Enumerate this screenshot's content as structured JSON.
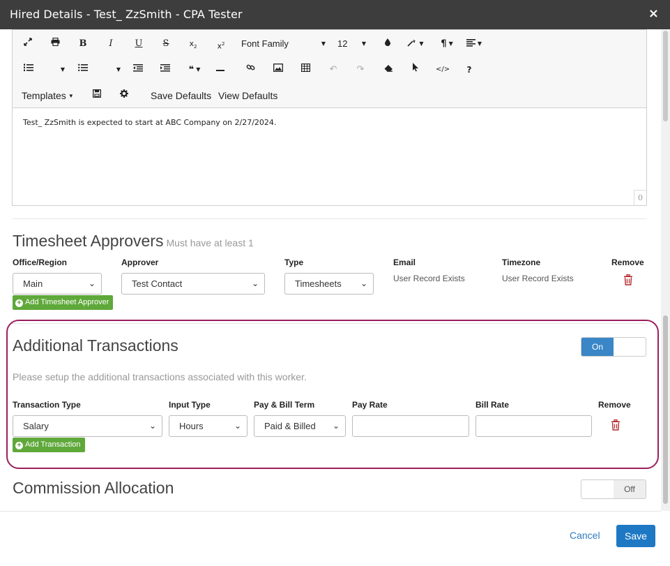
{
  "modal": {
    "title": "Hired Details - Test_ ZzSmith - CPA Tester",
    "close_label": "×"
  },
  "editor": {
    "font_family_label": "Font Family",
    "font_size": "12",
    "templates_label": "Templates",
    "save_defaults_label": "Save Defaults",
    "view_defaults_label": "View Defaults",
    "help_label": "?",
    "body_text": "Test_ ZzSmith is expected to start at ABC Company on 2/27/2024.",
    "char_count": "0",
    "icons": [
      "expand-icon",
      "print-icon",
      "bold-icon",
      "italic-icon",
      "underline-icon",
      "strikethrough-icon",
      "subscript-icon",
      "superscript-icon",
      "color-icon",
      "magic-icon",
      "paragraph-icon",
      "align-icon",
      "ordered-list-icon",
      "unordered-list-icon",
      "outdent-icon",
      "indent-icon",
      "quote-icon",
      "horizontal-rule-icon",
      "link-icon",
      "image-icon",
      "table-icon",
      "undo-icon",
      "redo-icon",
      "eraser-icon",
      "pointer-icon",
      "code-view-icon",
      "help-icon",
      "save-icon",
      "gear-icon"
    ]
  },
  "timesheet": {
    "title": "Timesheet Approvers",
    "note": "Must have at least 1",
    "headers": {
      "office": "Office/Region",
      "approver": "Approver",
      "type": "Type",
      "email": "Email",
      "timezone": "Timezone",
      "remove": "Remove"
    },
    "row": {
      "office": "Main",
      "approver": "Test Contact",
      "type": "Timesheets",
      "email": "User Record Exists",
      "timezone": "User Record Exists"
    },
    "add_label": "Add Timesheet Approver"
  },
  "transactions": {
    "title": "Additional Transactions",
    "toggle_label": "On",
    "description": "Please setup the additional transactions associated with this worker.",
    "headers": {
      "transaction_type": "Transaction Type",
      "input_type": "Input Type",
      "pay_bill_term": "Pay & Bill Term",
      "pay_rate": "Pay Rate",
      "bill_rate": "Bill Rate",
      "remove": "Remove"
    },
    "row": {
      "transaction_type": "Salary",
      "input_type": "Hours",
      "pay_bill_term": "Paid & Billed",
      "pay_rate": "",
      "bill_rate": ""
    },
    "add_label": "Add Transaction"
  },
  "commission": {
    "title": "Commission Allocation",
    "toggle_label": "Off"
  },
  "footer": {
    "cancel_label": "Cancel",
    "save_label": "Save"
  },
  "colors": {
    "header_bg": "#3d3d3d",
    "accent_blue": "#1f78c3",
    "add_green": "#5fa83a",
    "highlight": "#9a1f5c",
    "remove_red": "#b3262a"
  }
}
